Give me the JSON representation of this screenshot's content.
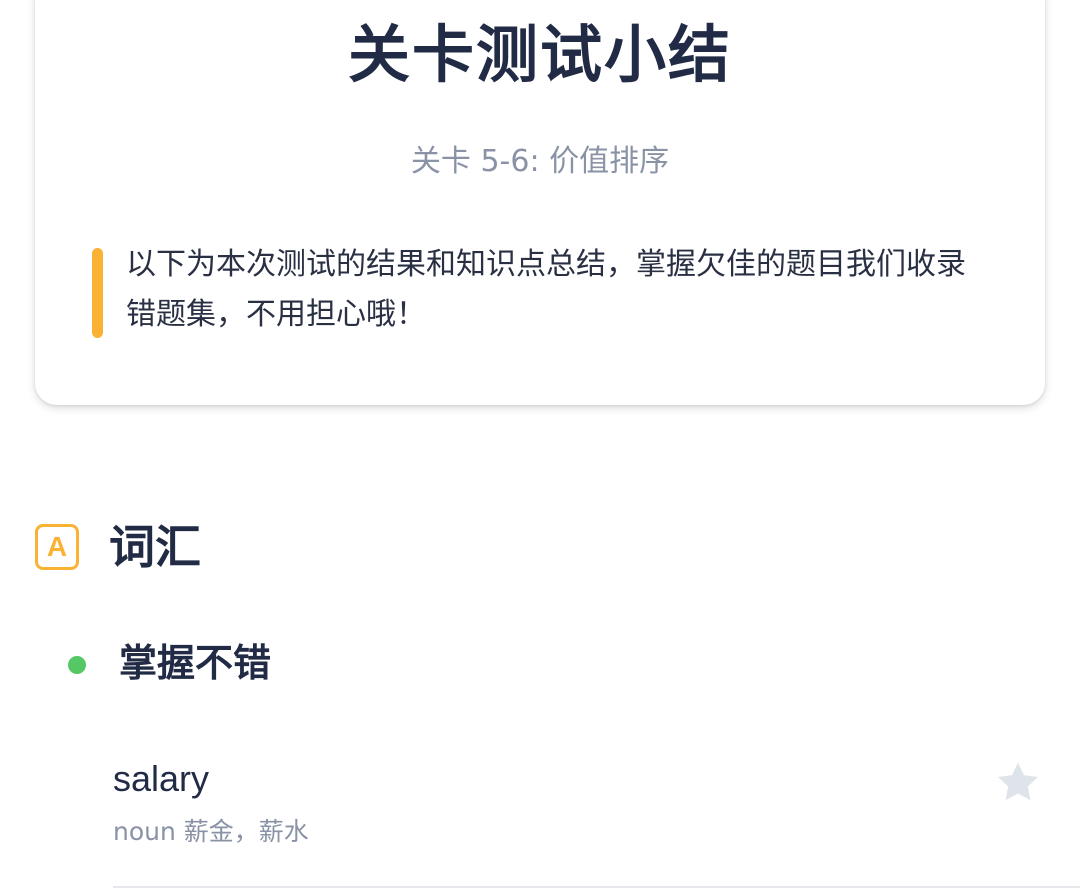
{
  "summary_card": {
    "title": "关卡测试小结",
    "subtitle": "关卡 5-6: 价值排序",
    "note": "以下为本次测试的结果和知识点总结，掌握欠佳的题目我们收录错题集，不用担心哦！"
  },
  "vocab_section": {
    "icon_letter": "A",
    "title": "词汇",
    "group": {
      "status_color": "#55c765",
      "title": "掌握不错",
      "items": [
        {
          "word": "salary",
          "definition": "noun 薪金，薪水",
          "favorite_icon": "star-icon"
        }
      ]
    }
  },
  "colors": {
    "accent": "#f9b233",
    "text_primary": "#222b45",
    "text_secondary": "#8a92a6",
    "star_inactive": "#dfe3ea"
  }
}
